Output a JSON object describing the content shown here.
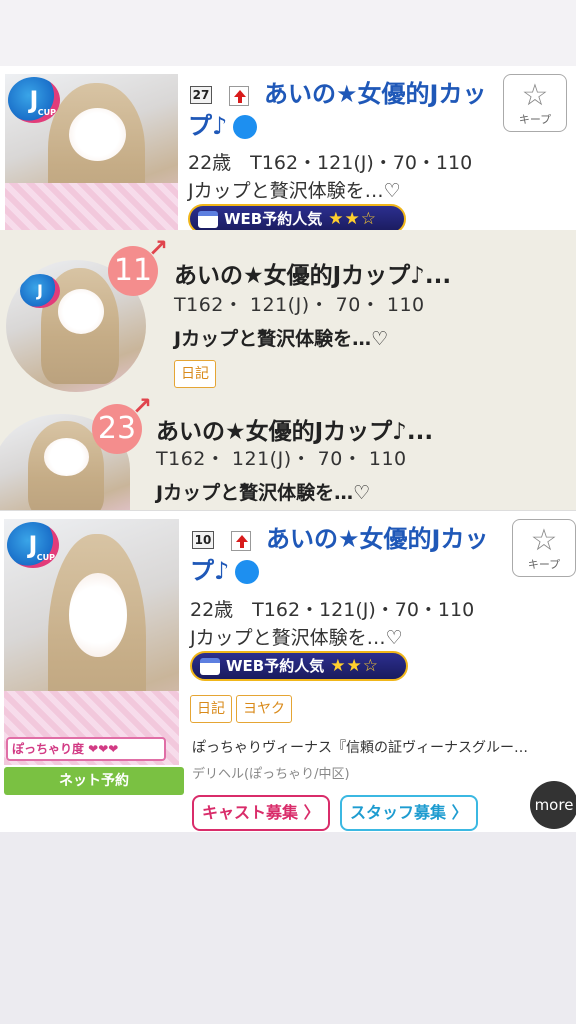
{
  "card1": {
    "rank": "27",
    "name": "あいの★女優的Jカップ♪",
    "verified_icon": "check-circle-icon",
    "keep_label": "キープ",
    "specs": "22歳　T162・121(J)・70・110",
    "catch": "Jカップと贅沢体験を…♡",
    "web_badge": "WEB予約人気",
    "web_stars": "★★☆",
    "jcup_logo": "J",
    "jcup_sub": "CUP"
  },
  "overlay": {
    "items": [
      {
        "rank": "11",
        "name": "あいの★女優的Jカップ♪...",
        "specs": "T162・ 121(J)・ 70・ 110",
        "catch": "Jカップと贅沢体験を…♡",
        "tag": "日記"
      },
      {
        "rank": "23",
        "name": "あいの★女優的Jカップ♪...",
        "specs": "T162・ 121(J)・ 70・ 110",
        "catch": "Jカップと贅沢体験を…♡"
      }
    ]
  },
  "card2": {
    "rank": "10",
    "name": "あいの★女優的Jカップ♪",
    "verified_icon": "check-circle-icon",
    "keep_label": "キープ",
    "specs": "22歳　T162・121(J)・70・110",
    "catch": "Jカップと贅沢体験を…♡",
    "web_badge": "WEB予約人気",
    "web_stars": "★★☆",
    "tags": [
      "日記",
      "ヨヤク"
    ],
    "pocha": "ぽっちゃり度 ❤❤❤",
    "net_button": "ネット予約",
    "shop": "ぽっちゃりヴィーナス『信頼の証ヴィーナスグルー…",
    "area": "デリヘル(ぽっちゃり/中区)",
    "cast_recruit": "キャスト募集 〉",
    "staff_recruit": "スタッフ募集 〉",
    "more": "more",
    "jcup_logo": "J",
    "jcup_sub": "CUP"
  },
  "colors": {
    "name_blue": "#1f58b8",
    "overlay_bg": "#efede4",
    "rank_circle": "#f48d8d",
    "badge_gold": "#f0b61a",
    "net_green": "#7ac142",
    "cast_pink": "#d92c6a",
    "staff_blue": "#3bb8e2"
  }
}
